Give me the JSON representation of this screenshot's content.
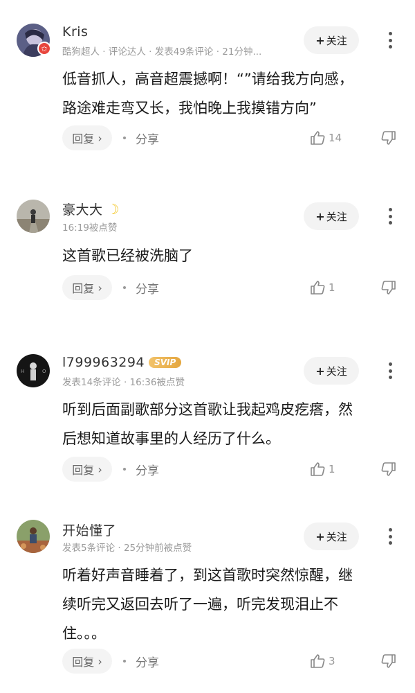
{
  "comments": [
    {
      "username": "Kris",
      "meta": "酷狗超人 · 评论达人 · 发表49条评论 · 21分钟...",
      "text_lines": [
        "低音抓人，高音超震撼啊！“”请给我方向感，",
        "路途难走弯又长，我怕晚上我摸错方向”"
      ],
      "follow_label": "关注",
      "reply_label": "回复",
      "share_label": "分享",
      "likes": "14",
      "avatar_icon": "anime-avatar-icon",
      "badge_icon": "star-badge-icon"
    },
    {
      "username": "豪大大",
      "meta": "16:19被点赞",
      "text_lines": [
        "这首歌已经被洗脑了"
      ],
      "follow_label": "关注",
      "reply_label": "回复",
      "share_label": "分享",
      "likes": "1",
      "avatar_icon": "person-road-avatar-icon",
      "name_suffix_icon": "moon-icon"
    },
    {
      "username": "l799963294",
      "vip_badge": "SVIP",
      "meta": "发表14条评论 · 16:36被点赞",
      "text_lines": [
        "听到后面副歌部分这首歌让我起鸡皮疙瘩，然",
        "后想知道故事里的人经历了什么。"
      ],
      "follow_label": "关注",
      "reply_label": "回复",
      "share_label": "分享",
      "likes": "1",
      "avatar_icon": "dark-figure-avatar-icon"
    },
    {
      "username": "开始懂了",
      "meta": "发表5条评论 · 25分钟前被点赞",
      "text_lines": [
        "听着好声音睡着了，到这首歌时突然惊醒，继",
        "续听完又返回去听了一遍，听完发现泪止不",
        "住。。。"
      ],
      "follow_label": "关注",
      "reply_label": "回复",
      "share_label": "分享",
      "likes": "3",
      "avatar_icon": "outdoor-person-avatar-icon"
    }
  ],
  "colors": {
    "meta_gray": "#9a9a9a",
    "button_bg": "#f3f3f3",
    "badge_red": "#e8453c",
    "svip_gold": "#e4a63f"
  }
}
